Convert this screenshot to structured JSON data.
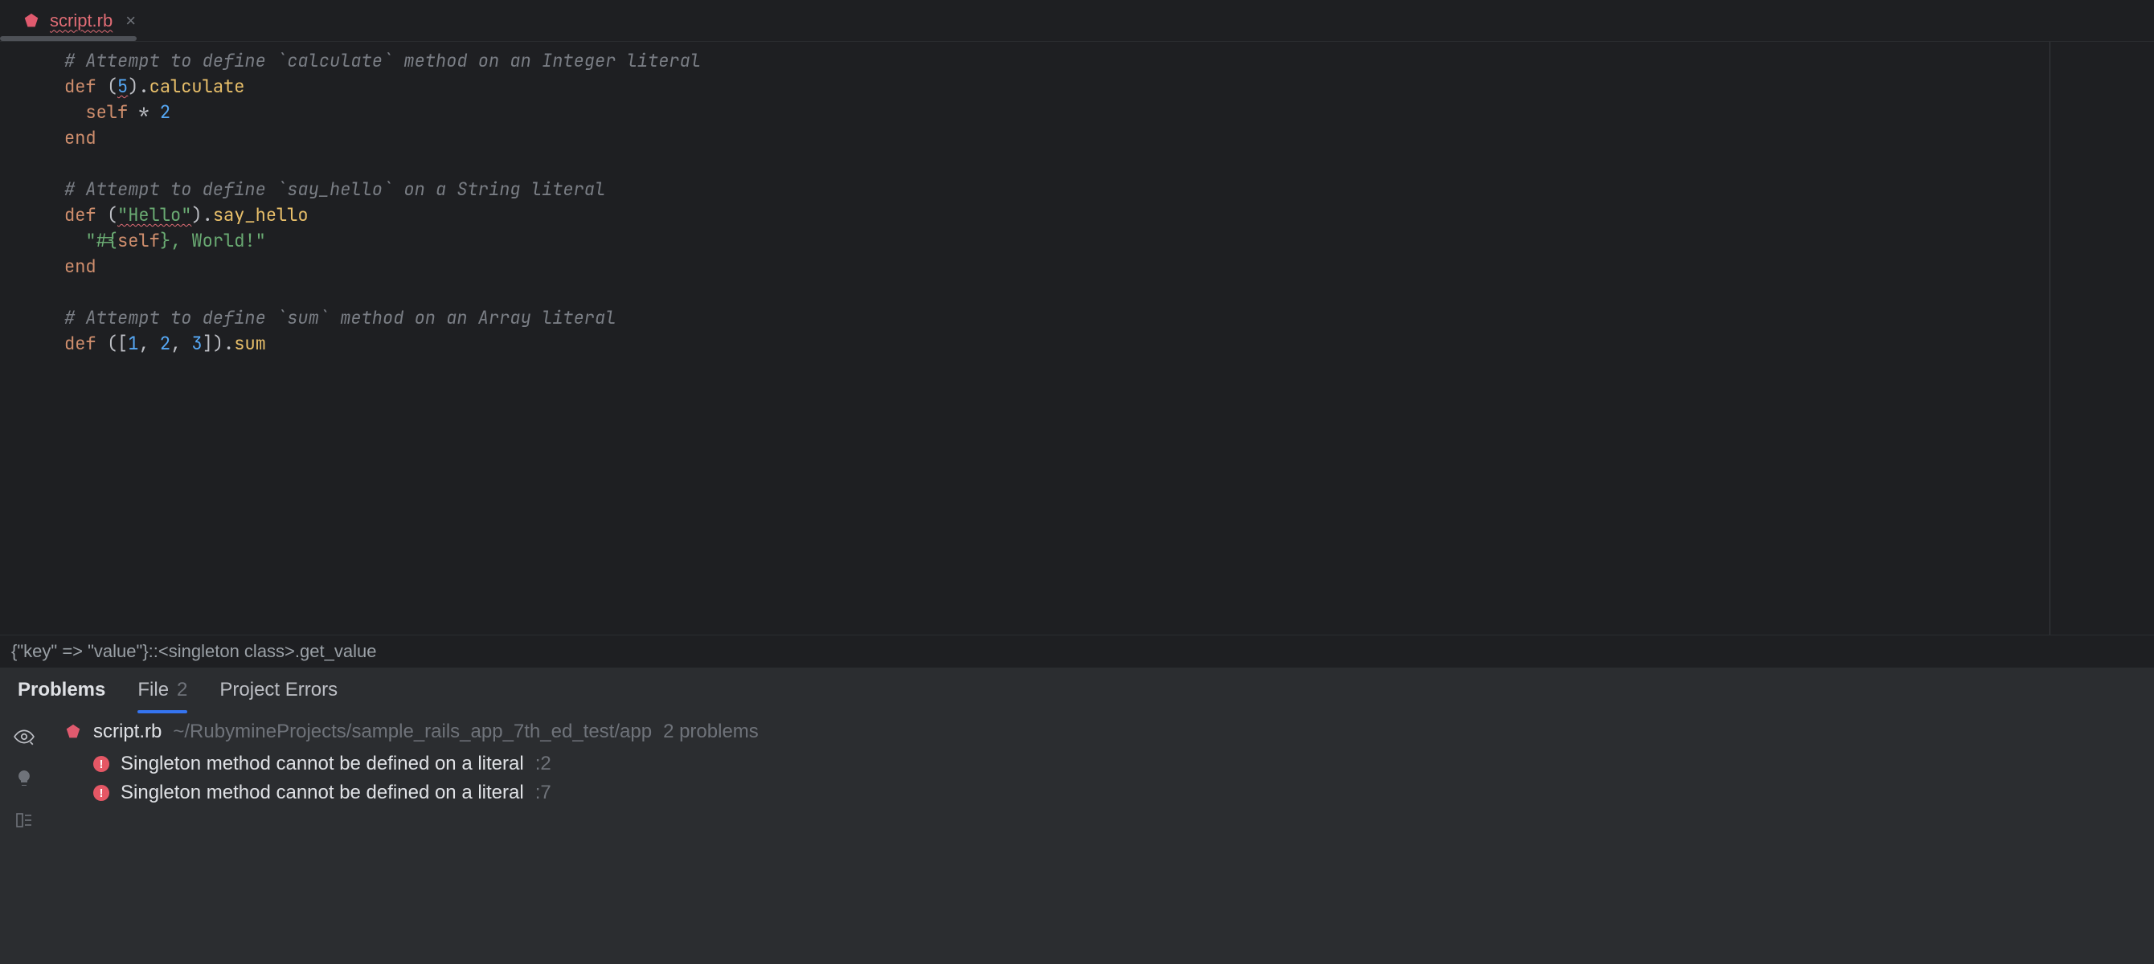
{
  "tab": {
    "filename": "script.rb",
    "close_glyph": "×"
  },
  "code": {
    "l1": "# Attempt to define `calculate` method on an Integer literal",
    "l2a": "def",
    "l2b": "(",
    "l2c": "5",
    "l2d": ").",
    "l2e": "calculate",
    "l3a": "self",
    "l3b": " * ",
    "l3c": "2",
    "l4": "end",
    "l6": "# Attempt to define `say_hello` on a String literal",
    "l7a": "def",
    "l7b": "(",
    "l7c": "\"Hello\"",
    "l7d": ").",
    "l7e": "say_hello",
    "l8a": "\"#{",
    "l8b": "self",
    "l8c": "}, World!\"",
    "l9": "end",
    "l11": "# Attempt to define `sum` method on an Array literal",
    "l12a": "def",
    "l12b": "([",
    "l12c": "1",
    "l12d": ", ",
    "l12e": "2",
    "l12f": ", ",
    "l12g": "3",
    "l12h": "]).",
    "l12i": "sum"
  },
  "breadcrumb": "{\"key\" => \"value\"}::<singleton class>.get_value",
  "panel": {
    "tabs": {
      "problems": "Problems",
      "file": "File",
      "file_count": "2",
      "project_errors": "Project Errors"
    },
    "file": {
      "name": "script.rb",
      "path": "~/RubymineProjects/sample_rails_app_7th_ed_test/app",
      "problem_count": "2 problems"
    },
    "problems": [
      {
        "msg": "Singleton method cannot be defined on a literal",
        "loc": ":2"
      },
      {
        "msg": "Singleton method cannot be defined on a literal",
        "loc": ":7"
      }
    ]
  }
}
